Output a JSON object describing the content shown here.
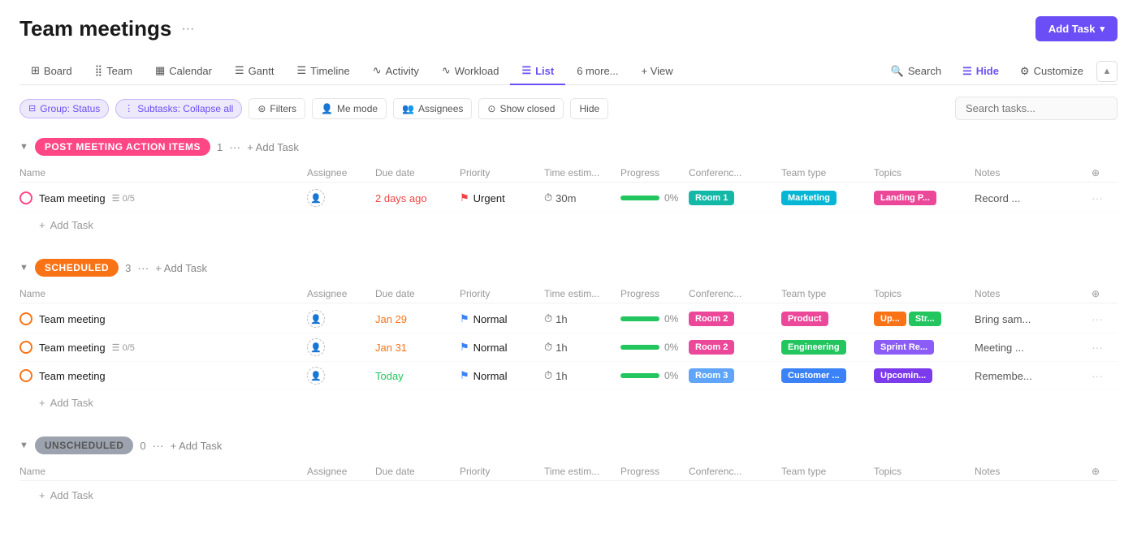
{
  "page": {
    "title": "Team meetings",
    "more_icon": "···",
    "add_task_button": "Add Task"
  },
  "nav": {
    "tabs": [
      {
        "id": "board",
        "label": "Board",
        "icon": "⊞",
        "active": false
      },
      {
        "id": "team",
        "label": "Team",
        "icon": "⣿",
        "active": false
      },
      {
        "id": "calendar",
        "label": "Calendar",
        "icon": "▦",
        "active": false
      },
      {
        "id": "gantt",
        "label": "Gantt",
        "icon": "☰",
        "active": false
      },
      {
        "id": "timeline",
        "label": "Timeline",
        "icon": "☰",
        "active": false
      },
      {
        "id": "activity",
        "label": "Activity",
        "icon": "∿",
        "active": false
      },
      {
        "id": "workload",
        "label": "Workload",
        "icon": "∿",
        "active": false
      },
      {
        "id": "list",
        "label": "List",
        "icon": "☰",
        "active": true
      },
      {
        "id": "more",
        "label": "6 more...",
        "icon": "",
        "active": false
      }
    ],
    "add_view": "+ View",
    "search_label": "Search",
    "hide_label": "Hide",
    "customize_label": "Customize"
  },
  "toolbar": {
    "group_status_label": "Group: Status",
    "subtasks_label": "Subtasks: Collapse all",
    "filters_label": "Filters",
    "me_mode_label": "Me mode",
    "assignees_label": "Assignees",
    "show_closed_label": "Show closed",
    "hide_label": "Hide",
    "search_placeholder": "Search tasks..."
  },
  "columns": {
    "name": "Name",
    "assignee": "Assignee",
    "due_date": "Due date",
    "priority": "Priority",
    "time_estim": "Time estim...",
    "progress": "Progress",
    "conference": "Conferenc...",
    "team_type": "Team type",
    "topics": "Topics",
    "notes": "Notes"
  },
  "sections": [
    {
      "id": "post-meeting",
      "label": "POST MEETING ACTION ITEMS",
      "badge_color": "pink",
      "icon": "🔴",
      "count": "1",
      "add_task": "Add Task",
      "tasks": [
        {
          "name": "Team meeting",
          "subtask_count": "0/5",
          "assignee": "",
          "due_date": "2 days ago",
          "due_class": "overdue",
          "priority": "Urgent",
          "priority_flag_color": "red",
          "time_estim": "30m",
          "progress": 0,
          "conference": "Room 1",
          "conference_color": "teal",
          "team_type": "Marketing",
          "team_type_color": "cyan",
          "topics": [
            "Landing P..."
          ],
          "topics_colors": [
            "pink"
          ],
          "notes": "Record ..."
        }
      ]
    },
    {
      "id": "scheduled",
      "label": "SCHEDULED",
      "badge_color": "orange",
      "icon": "🟠",
      "count": "3",
      "add_task": "Add Task",
      "tasks": [
        {
          "name": "Team meeting",
          "subtask_count": null,
          "assignee": "",
          "due_date": "Jan 29",
          "due_class": "upcoming",
          "priority": "Normal",
          "priority_flag_color": "blue",
          "time_estim": "1h",
          "progress": 0,
          "conference": "Room 2",
          "conference_color": "pink",
          "team_type": "Product",
          "team_type_color": "pink",
          "topics": [
            "Up...",
            "Str..."
          ],
          "topics_colors": [
            "orange",
            "green"
          ],
          "notes": "Bring sam..."
        },
        {
          "name": "Team meeting",
          "subtask_count": "0/5",
          "assignee": "",
          "due_date": "Jan 31",
          "due_class": "upcoming",
          "priority": "Normal",
          "priority_flag_color": "blue",
          "time_estim": "1h",
          "progress": 0,
          "conference": "Room 2",
          "conference_color": "pink",
          "team_type": "Engineering",
          "team_type_color": "green",
          "topics": [
            "Sprint Re..."
          ],
          "topics_colors": [
            "purple"
          ],
          "notes": "Meeting ..."
        },
        {
          "name": "Team meeting",
          "subtask_count": null,
          "assignee": "",
          "due_date": "Today",
          "due_class": "today",
          "priority": "Normal",
          "priority_flag_color": "blue",
          "time_estim": "1h",
          "progress": 0,
          "conference": "Room 3",
          "conference_color": "light-blue",
          "team_type": "Customer ...",
          "team_type_color": "blue",
          "topics": [
            "Upcomin..."
          ],
          "topics_colors": [
            "violet"
          ],
          "notes": "Remembe..."
        }
      ]
    },
    {
      "id": "unscheduled",
      "label": "UNSCHEDULED",
      "badge_color": "gray",
      "icon": "⭕",
      "count": "0",
      "add_task": "Add Task",
      "tasks": []
    }
  ]
}
